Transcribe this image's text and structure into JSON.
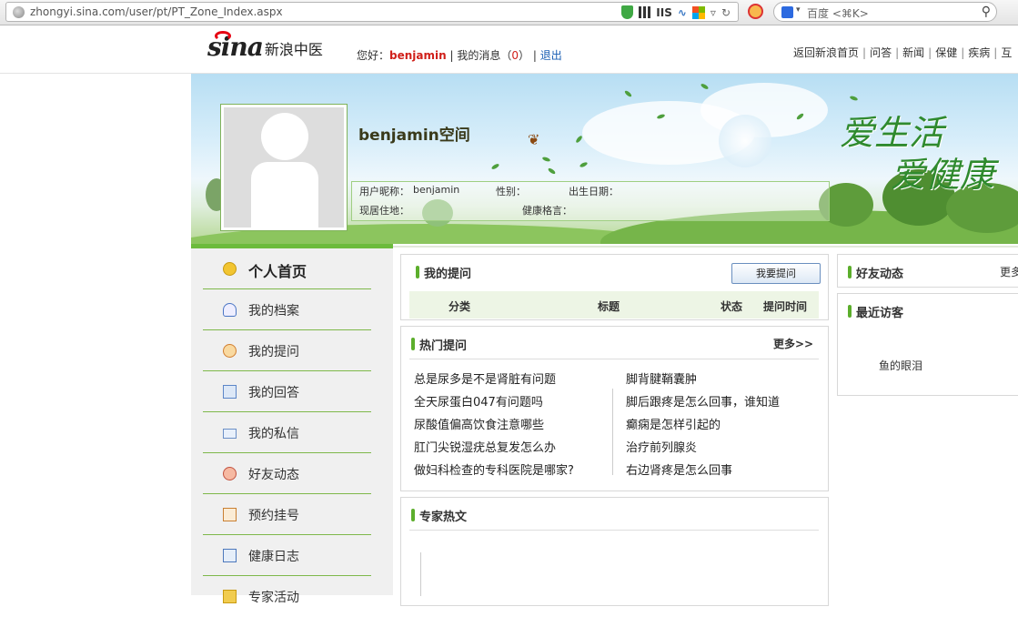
{
  "browser": {
    "url": "zhongyi.sina.com/user/pt/PT_Zone_Index.aspx",
    "iis_label": "IIS",
    "search_placeholder": "百度 <⌘K>",
    "icons": [
      "globe-icon",
      "shield-icon",
      "qr-icon",
      "wave-icon",
      "windows-icon",
      "dropdown-icon",
      "reload-icon",
      "block-icon",
      "baidu-icon",
      "search-icon"
    ]
  },
  "header": {
    "logo_sina": "sina",
    "logo_text": "新浪中医",
    "greeting_prefix": "您好：",
    "username": "benjamin",
    "sep": "|",
    "messages_label": "我的消息（",
    "messages_count": "0",
    "messages_close": "）",
    "logout": "退出",
    "nav": [
      "返回新浪首页",
      "问答",
      "新闻",
      "保健",
      "疾病",
      "互"
    ]
  },
  "banner": {
    "space_title": "benjamin空间",
    "slogan_line1": "爱生活",
    "slogan_line2": "爱健康",
    "nickname_label": "用户昵称：",
    "nickname": "benjamin",
    "gender_label": "性别：",
    "birthday_label": "出生日期：",
    "residence_label": "现居住地：",
    "motto_label": "健康格言："
  },
  "sidebar": {
    "items": [
      {
        "label": "个人首页",
        "icon": "smile-icon"
      },
      {
        "label": "我的档案",
        "icon": "profile-icon"
      },
      {
        "label": "我的提问",
        "icon": "chat-icon"
      },
      {
        "label": "我的回答",
        "icon": "list-icon"
      },
      {
        "label": "我的私信",
        "icon": "mail-icon"
      },
      {
        "label": "好友动态",
        "icon": "friends-icon"
      },
      {
        "label": "预约挂号",
        "icon": "calendar-icon"
      },
      {
        "label": "健康日志",
        "icon": "card-icon"
      },
      {
        "label": "专家活动",
        "icon": "activity-icon"
      }
    ]
  },
  "my_questions": {
    "title": "我的提问",
    "ask_button": "我要提问",
    "columns": [
      "分类",
      "标题",
      "状态",
      "提问时间"
    ]
  },
  "hot_questions": {
    "title": "热门提问",
    "more": "更多>>",
    "left": [
      "总是尿多是不是肾脏有问题",
      "全天尿蛋白047有问题吗",
      "尿酸值偏高饮食注意哪些",
      "肛门尖锐湿疣总复发怎么办",
      "做妇科检查的专科医院是哪家?"
    ],
    "right": [
      "脚背腱鞘囊肿",
      "脚后跟疼是怎么回事，谁知道",
      "癫痫是怎样引起的",
      "治疗前列腺炎",
      "右边肾疼是怎么回事"
    ]
  },
  "expert_articles": {
    "title": "专家热文"
  },
  "friend_updates": {
    "title": "好友动态",
    "more": "更多"
  },
  "recent_visitors": {
    "title": "最近访客",
    "visitors": [
      "鱼的眼泪"
    ]
  },
  "colors": {
    "accent_green": "#5cae2c",
    "highlight_red": "#d0201a",
    "link_blue": "#1a5fb4"
  }
}
